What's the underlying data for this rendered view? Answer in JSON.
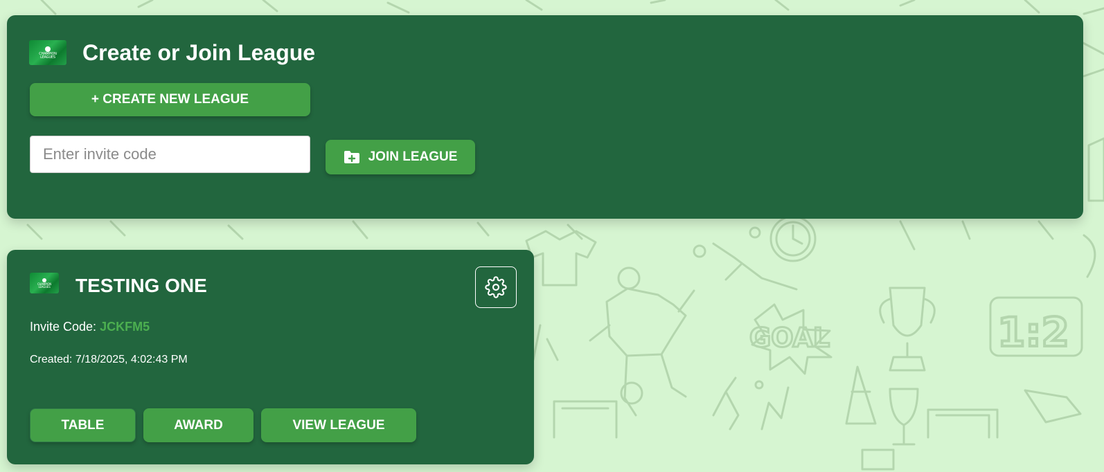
{
  "colors": {
    "background": "#d6f5d1",
    "card": "#22663e",
    "button": "#43a047",
    "invite_code": "#4caf50"
  },
  "create_join": {
    "logo_text": [
      "CHAMPION",
      "LEAGUES"
    ],
    "title": "Create or Join League",
    "create_button_label": "+ CREATE NEW LEAGUE",
    "invite_input": {
      "placeholder": "Enter invite code",
      "value": ""
    },
    "join_button_label": "JOIN LEAGUE",
    "join_button_icon": "folder-plus-icon"
  },
  "league": {
    "logo_text": [
      "CHAMPION",
      "LEAGUES"
    ],
    "name": "TESTING ONE",
    "settings_icon": "gear-icon",
    "invite_label": "Invite Code:",
    "invite_code": "JCKFM5",
    "created_label": "Created:",
    "created_value": "7/18/2025, 4:02:43 PM",
    "buttons": {
      "table": "TABLE",
      "award": "AWARD",
      "view": "VIEW LEAGUE"
    }
  },
  "background_doodle_text": [
    "GOAL",
    "1:2"
  ]
}
